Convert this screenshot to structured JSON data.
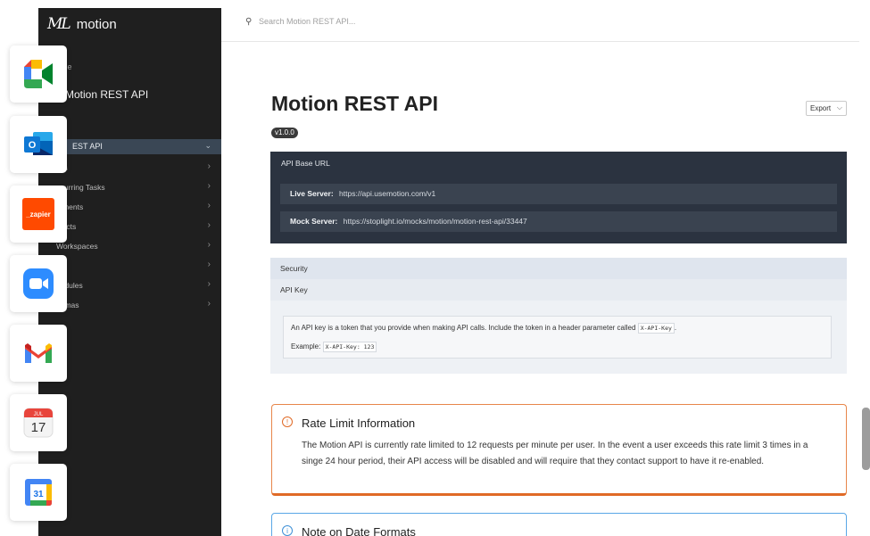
{
  "sidebar": {
    "logo_mark": "ML",
    "logo_text": "motion",
    "home": "ome",
    "title": "Motion REST API",
    "active_item": "EST API",
    "items": [
      {
        "label": "sks"
      },
      {
        "label": "ecurring Tasks"
      },
      {
        "label": "mments"
      },
      {
        "label": "ojects"
      },
      {
        "label": "Workspaces"
      },
      {
        "label": "ers"
      },
      {
        "label": "hedules"
      },
      {
        "label": "hemas"
      }
    ]
  },
  "search": {
    "placeholder": "Search Motion REST API..."
  },
  "page": {
    "title": "Motion REST API",
    "version": "v1.0.0",
    "export_label": "Export"
  },
  "base_url": {
    "heading": "API Base URL",
    "live_label": "Live Server:",
    "live_value": "https://api.usemotion.com/v1",
    "mock_label": "Mock Server:",
    "mock_value": "https://stoplight.io/mocks/motion/motion-rest-api/33447"
  },
  "security": {
    "heading": "Security",
    "subheading": "API Key",
    "description": "An API key is a token that you provide when making API calls. Include the token in a header parameter called",
    "header_name": "X-API-Key",
    "description_end": ".",
    "example_label": "Example:",
    "example_value": "X-API-Key: 123"
  },
  "rate_limit": {
    "title": "Rate Limit Information",
    "text": "The Motion API is currently rate limited to 12 requests per minute per user. In the event a user exceeds this rate limit 3 times in a singe 24 hour period, their API access will be disabled and will require that they contact support to have it re-enabled."
  },
  "note": {
    "title": "Note on Date Formats"
  },
  "dock": {
    "icons": [
      "google-meet-icon",
      "outlook-icon",
      "zapier-icon",
      "zoom-icon",
      "gmail-icon",
      "apple-calendar-icon",
      "google-calendar-icon"
    ],
    "zapier_text": "_zapier",
    "calendar_month": "JUL",
    "calendar_day": "17",
    "gcal_day": "31"
  },
  "colors": {
    "sidebar_bg": "#1f1f1f",
    "base_panel_bg": "#2b3340",
    "rate_accent": "#e06a26",
    "note_accent": "#3d8fd6"
  }
}
